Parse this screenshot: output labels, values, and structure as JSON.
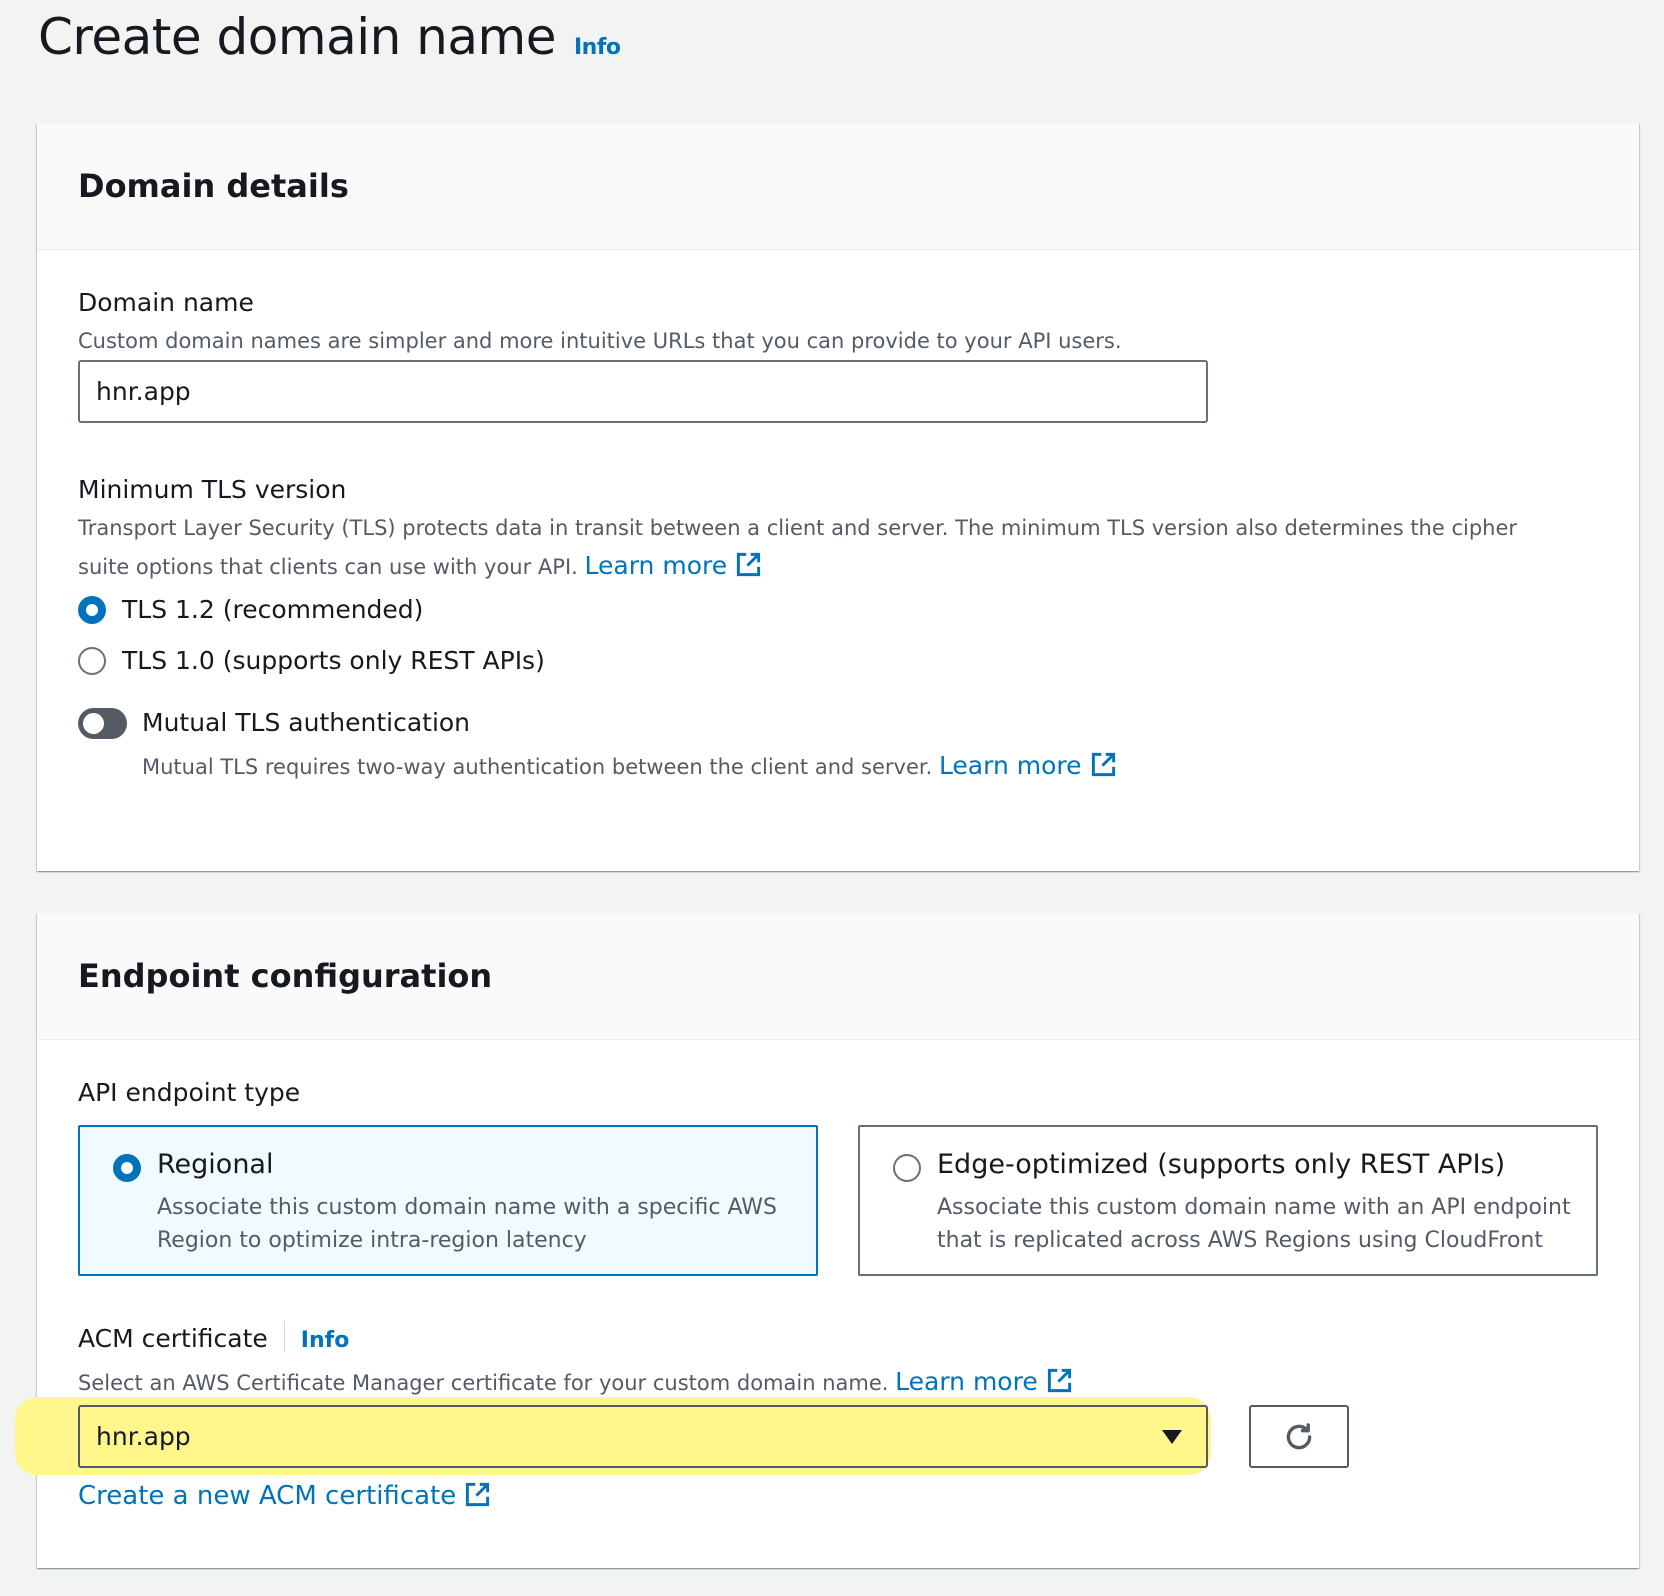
{
  "page": {
    "title": "Create domain name",
    "info_label": "Info"
  },
  "domain_details": {
    "header": "Domain details",
    "domain_name": {
      "label": "Domain name",
      "description": "Custom domain names are simpler and more intuitive URLs that you can provide to your API users.",
      "value": "hnr.app"
    },
    "tls": {
      "label": "Minimum TLS version",
      "description_line1": "Transport Layer Security (TLS) protects data in transit between a client and server. The minimum TLS version also determines the cipher",
      "description_line2": "suite options that clients can use with your API.",
      "learn_more": "Learn more",
      "options": [
        {
          "label": "TLS 1.2 (recommended)",
          "selected": true
        },
        {
          "label": "TLS 1.0 (supports only REST APIs)",
          "selected": false
        }
      ]
    },
    "mutual_tls": {
      "label": "Mutual TLS authentication",
      "enabled": false,
      "description": "Mutual TLS requires two-way authentication between the client and server.",
      "learn_more": "Learn more"
    }
  },
  "endpoint_configuration": {
    "header": "Endpoint configuration",
    "endpoint_type": {
      "label": "API endpoint type",
      "options": [
        {
          "title": "Regional",
          "desc_line1": "Associate this custom domain name with a specific AWS",
          "desc_line2": "Region to optimize intra-region latency",
          "selected": true
        },
        {
          "title": "Edge-optimized (supports only REST APIs)",
          "desc_line1": "Associate this custom domain name with an API endpoint",
          "desc_line2": "that is replicated across AWS Regions using CloudFront",
          "selected": false
        }
      ]
    },
    "acm": {
      "label": "ACM certificate",
      "info_label": "Info",
      "description": "Select an AWS Certificate Manager certificate for your custom domain name.",
      "learn_more": "Learn more",
      "selected_value": "hnr.app",
      "create_link": "Create a new ACM certificate"
    }
  },
  "icons": {
    "external_link": "external-link-icon",
    "refresh": "refresh-icon",
    "caret": "caret-down-icon"
  },
  "colors": {
    "link": "#0073bb",
    "highlight": "#fff78c",
    "selected_tile_bg": "#f1faff"
  }
}
